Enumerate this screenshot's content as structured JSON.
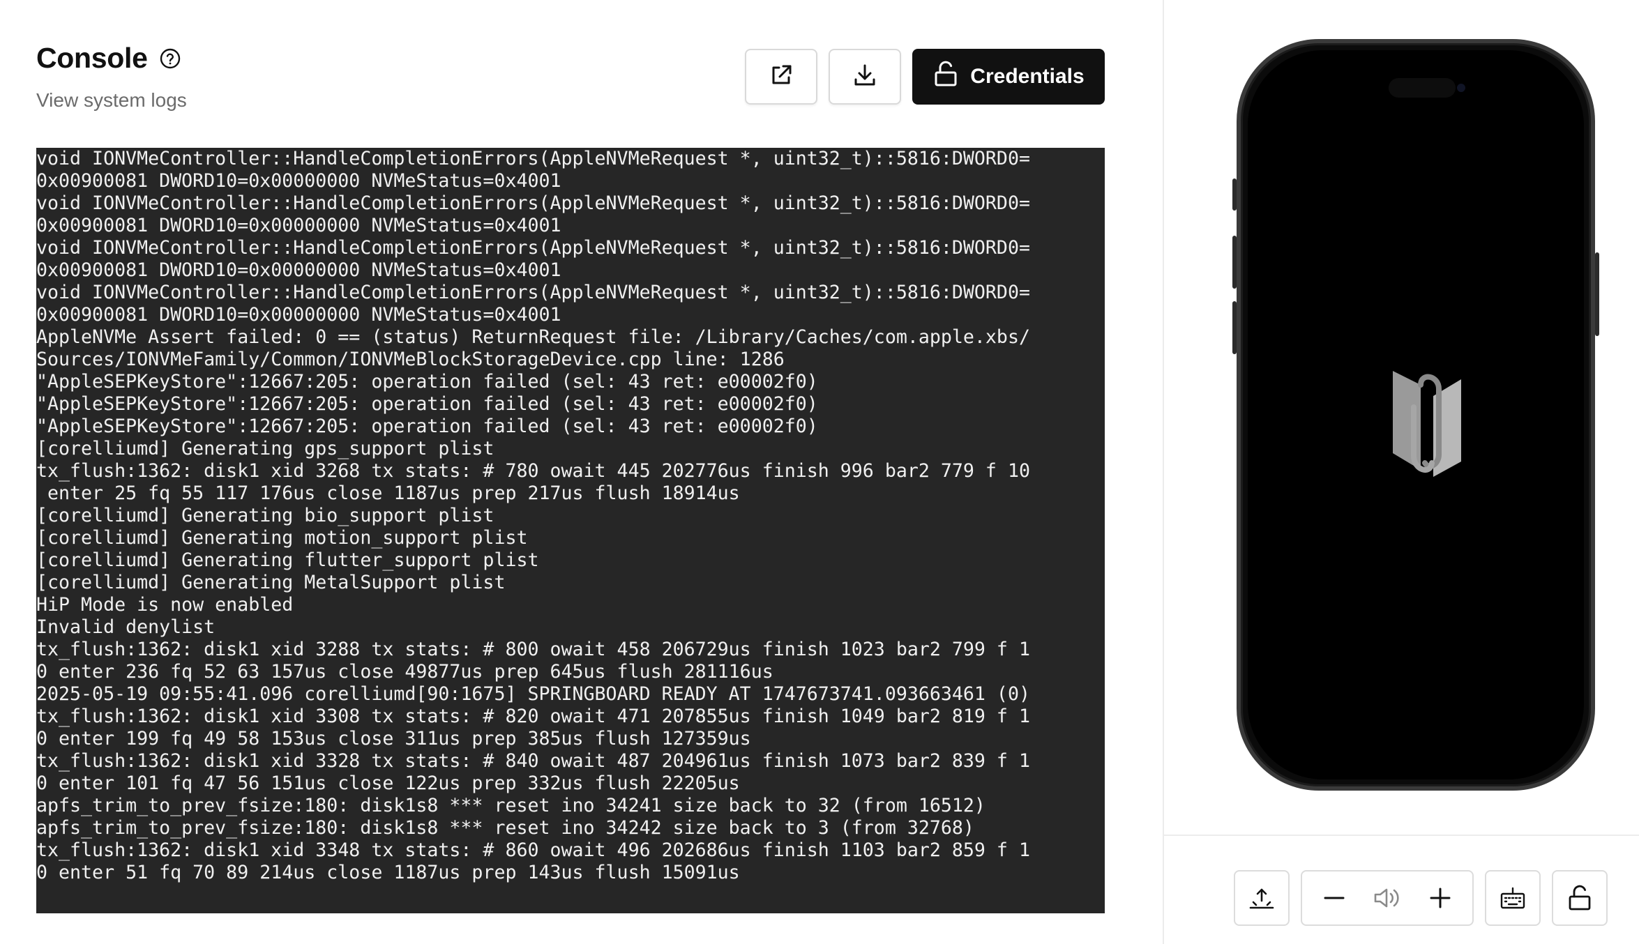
{
  "header": {
    "title": "Console",
    "subtitle": "View system logs",
    "credentials_label": "Credentials"
  },
  "icons": {
    "help": "question-circle-icon",
    "open_external": "external-link-icon",
    "download": "download-icon",
    "credentials": "unlock-icon",
    "home": "home-swipe-icon",
    "volume_down": "minus-icon",
    "volume": "speaker-icon",
    "volume_up": "plus-icon",
    "keyboard": "keyboard-icon",
    "lock": "unlock-icon"
  },
  "colors": {
    "console_bg": "#262626",
    "console_text": "#f0f0f0",
    "primary_button": "#111111"
  },
  "console": {
    "lines": [
      "void IONVMeController::HandleCompletionErrors(AppleNVMeRequest *, uint32_t)::5816:DWORD0=",
      "0x00900081 DWORD10=0x00000000 NVMeStatus=0x4001",
      "void IONVMeController::HandleCompletionErrors(AppleNVMeRequest *, uint32_t)::5816:DWORD0=",
      "0x00900081 DWORD10=0x00000000 NVMeStatus=0x4001",
      "void IONVMeController::HandleCompletionErrors(AppleNVMeRequest *, uint32_t)::5816:DWORD0=",
      "0x00900081 DWORD10=0x00000000 NVMeStatus=0x4001",
      "void IONVMeController::HandleCompletionErrors(AppleNVMeRequest *, uint32_t)::5816:DWORD0=",
      "0x00900081 DWORD10=0x00000000 NVMeStatus=0x4001",
      "AppleNVMe Assert failed: 0 == (status) ReturnRequest file: /Library/Caches/com.apple.xbs/",
      "Sources/IONVMeFamily/Common/IONVMeBlockStorageDevice.cpp line: 1286",
      "\"AppleSEPKeyStore\":12667:205: operation failed (sel: 43 ret: e00002f0)",
      "\"AppleSEPKeyStore\":12667:205: operation failed (sel: 43 ret: e00002f0)",
      "\"AppleSEPKeyStore\":12667:205: operation failed (sel: 43 ret: e00002f0)",
      "[corelliumd] Generating gps_support plist",
      "tx_flush:1362: disk1 xid 3268 tx stats: # 780 owait 445 202776us finish 996 bar2 779 f 10",
      " enter 25 fq 55 117 176us close 1187us prep 217us flush 18914us",
      "[corelliumd] Generating bio_support plist",
      "[corelliumd] Generating motion_support plist",
      "[corelliumd] Generating flutter_support plist",
      "[corelliumd] Generating MetalSupport plist",
      "HiP Mode is now enabled",
      "Invalid denylist",
      "tx_flush:1362: disk1 xid 3288 tx stats: # 800 owait 458 206729us finish 1023 bar2 799 f 1",
      "0 enter 236 fq 52 63 157us close 49877us prep 645us flush 281116us",
      "2025-05-19 09:55:41.096 corelliumd[90:1675] SPRINGBOARD READY AT 1747673741.093663461 (0)",
      "tx_flush:1362: disk1 xid 3308 tx stats: # 820 owait 471 207855us finish 1049 bar2 819 f 1",
      "0 enter 199 fq 49 58 153us close 311us prep 385us flush 127359us",
      "tx_flush:1362: disk1 xid 3328 tx stats: # 840 owait 487 204961us finish 1073 bar2 839 f 1",
      "0 enter 101 fq 47 56 151us close 122us prep 332us flush 22205us",
      "apfs_trim_to_prev_fsize:180: disk1s8 *** reset ino 34241 size back to 32 (from 16512)",
      "apfs_trim_to_prev_fsize:180: disk1s8 *** reset ino 34242 size back to 3 (from 32768)",
      "tx_flush:1362: disk1 xid 3348 tx stats: # 860 owait 496 202686us finish 1103 bar2 859 f 1",
      "0 enter 51 fq 70 89 214us close 1187us prep 143us flush 15091us"
    ]
  }
}
